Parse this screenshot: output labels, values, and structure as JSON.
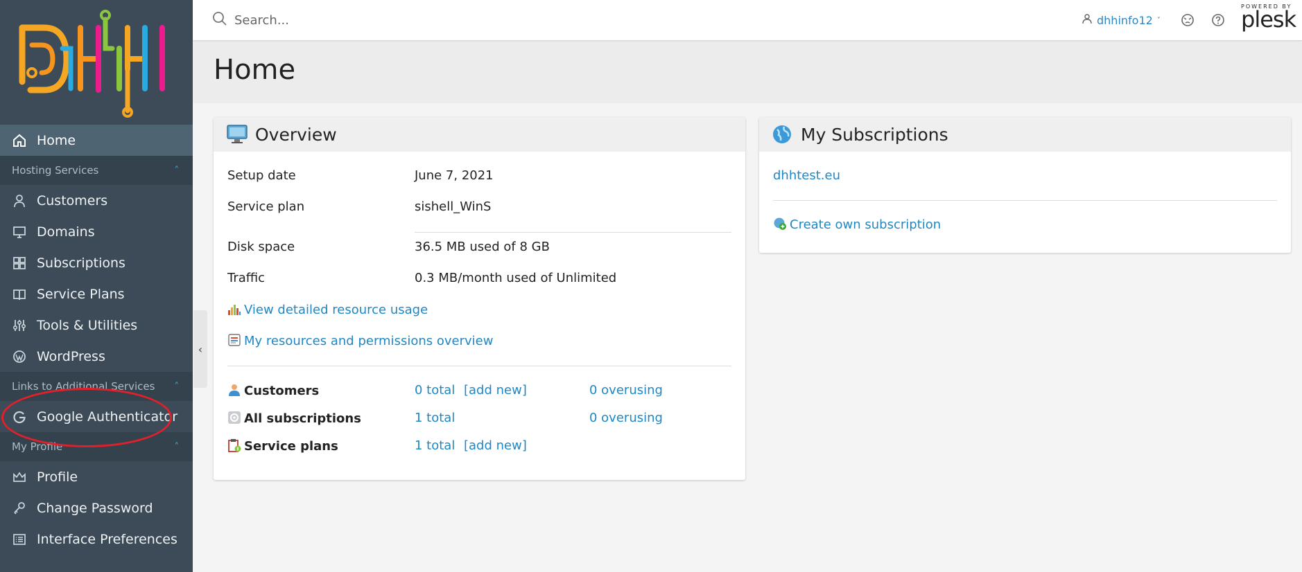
{
  "sidebar": {
    "items_main": [
      {
        "label": "Home",
        "icon": "home-icon",
        "active": true
      }
    ],
    "sections": [
      {
        "title": "Hosting Services",
        "items": [
          {
            "label": "Customers",
            "icon": "user-icon"
          },
          {
            "label": "Domains",
            "icon": "monitor-icon"
          },
          {
            "label": "Subscriptions",
            "icon": "grid-icon"
          },
          {
            "label": "Service Plans",
            "icon": "book-icon"
          },
          {
            "label": "Tools & Utilities",
            "icon": "sliders-icon"
          },
          {
            "label": "WordPress",
            "icon": "wordpress-icon"
          }
        ]
      },
      {
        "title": "Links to Additional Services",
        "items": [
          {
            "label": "Google Authenticator",
            "icon": "google-icon"
          }
        ]
      },
      {
        "title": "My Profile",
        "items": [
          {
            "label": "Profile",
            "icon": "crown-icon"
          },
          {
            "label": "Change Password",
            "icon": "key-icon"
          },
          {
            "label": "Interface Preferences",
            "icon": "list-icon"
          }
        ]
      }
    ]
  },
  "topbar": {
    "search_placeholder": "Search...",
    "username": "dhhinfo12",
    "powered_by": "POWERED BY",
    "brand": "plesk"
  },
  "page": {
    "title": "Home"
  },
  "overview": {
    "title": "Overview",
    "setup_date_label": "Setup date",
    "setup_date_value": "June 7, 2021",
    "service_plan_label": "Service plan",
    "service_plan_value": "sishell_WinS",
    "disk_label": "Disk space",
    "disk_value": "36.5 MB used of 8 GB",
    "traffic_label": "Traffic",
    "traffic_value": "0.3 MB/month used of Unlimited",
    "link_resource_usage": "View detailed resource usage",
    "link_permissions": "My resources and permissions overview",
    "stats": [
      {
        "label": "Customers",
        "total": "0 total",
        "add": "[add new]",
        "over": "0 overusing"
      },
      {
        "label": "All subscriptions",
        "total": "1 total",
        "add": "",
        "over": "0 overusing"
      },
      {
        "label": "Service plans",
        "total": "1 total",
        "add": "[add new]",
        "over": ""
      }
    ]
  },
  "subscriptions": {
    "title": "My Subscriptions",
    "domain": "dhhtest.eu",
    "create_link": "Create own subscription"
  },
  "colors": {
    "sidebar": "#3c4b57",
    "link": "#1f87c3",
    "annotation": "#e0202a"
  }
}
